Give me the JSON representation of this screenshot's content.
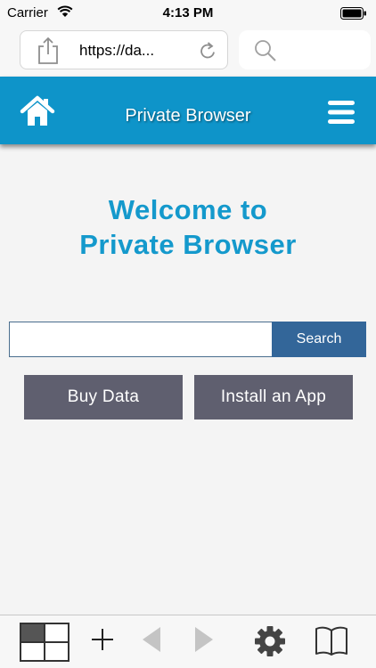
{
  "status_bar": {
    "carrier": "Carrier",
    "time": "4:13 PM",
    "icons": [
      "wifi-icon",
      "battery-icon"
    ]
  },
  "address_bar": {
    "url": "https://da...",
    "icons": [
      "share-icon",
      "reload-icon",
      "search-icon"
    ]
  },
  "header": {
    "title": "Private Browser",
    "icons": [
      "home-icon",
      "menu-icon"
    ],
    "background_color": "#0e94c9"
  },
  "welcome": {
    "line1": "Welcome to",
    "line2": "Private Browser",
    "color": "#1499cc"
  },
  "search": {
    "value": "",
    "button_label": "Search",
    "button_color": "#336699"
  },
  "actions": {
    "buy_label": "Buy Data",
    "install_label": "Install an App",
    "button_color": "#5f5f6f"
  },
  "toolbar": {
    "icons": [
      "tabs-icon",
      "plus-icon",
      "back-icon",
      "forward-icon",
      "gear-icon",
      "book-icon"
    ]
  }
}
